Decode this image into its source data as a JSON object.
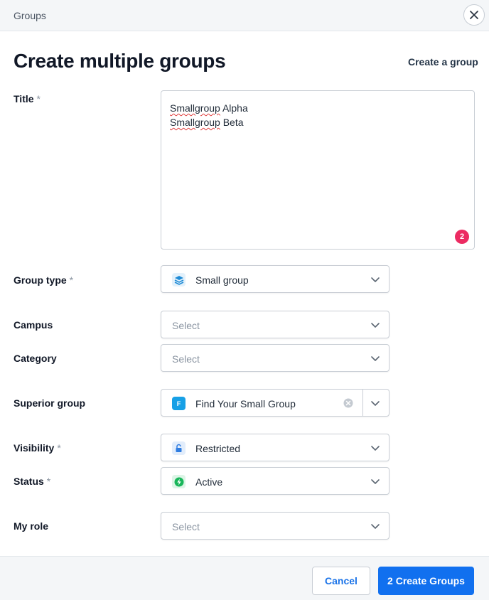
{
  "header": {
    "breadcrumb": "Groups",
    "close_icon": "close-icon"
  },
  "page": {
    "title": "Create multiple groups",
    "switch_link": "Create a group"
  },
  "form": {
    "title": {
      "label": "Title",
      "required_mark": "*",
      "lines": [
        {
          "misspelled": "Smallgroup",
          "rest": " Alpha"
        },
        {
          "misspelled": "Smallgroup",
          "rest": " Beta"
        }
      ],
      "count_badge": "2"
    },
    "group_type": {
      "label": "Group type",
      "required_mark": "*",
      "value": "Small group",
      "icon": "layers-icon",
      "icon_color": "#1f8bd6"
    },
    "campus": {
      "label": "Campus",
      "placeholder": "Select"
    },
    "category": {
      "label": "Category",
      "placeholder": "Select"
    },
    "superior_group": {
      "label": "Superior group",
      "value": "Find Your Small Group",
      "badge_letter": "F",
      "icon_color": "#17a0e6"
    },
    "visibility": {
      "label": "Visibility",
      "required_mark": "*",
      "value": "Restricted",
      "icon": "unlock-icon",
      "icon_color": "#2f7de1"
    },
    "status": {
      "label": "Status",
      "required_mark": "*",
      "value": "Active",
      "icon": "lightning-icon",
      "icon_color": "#19b65a"
    },
    "my_role": {
      "label": "My role",
      "placeholder": "Select"
    }
  },
  "footer": {
    "cancel_label": "Cancel",
    "submit_label": "2 Create Groups"
  },
  "colors": {
    "primary": "#1170ef",
    "badge": "#ec2b62"
  }
}
